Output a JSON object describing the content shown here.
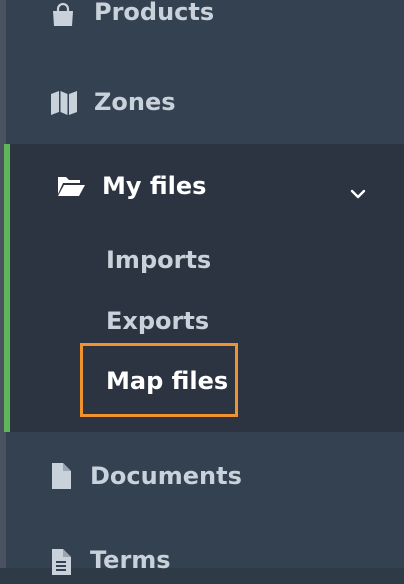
{
  "sidebar": {
    "items": [
      {
        "label": "Products",
        "icon": "shopping-bag-icon"
      },
      {
        "label": "Zones",
        "icon": "map-icon"
      },
      {
        "label": "My files",
        "icon": "folder-open-icon",
        "expanded": true,
        "children": [
          {
            "label": "Imports"
          },
          {
            "label": "Exports"
          },
          {
            "label": "Map files",
            "highlighted": true
          }
        ]
      },
      {
        "label": "Documents",
        "icon": "file-icon"
      },
      {
        "label": "Terms",
        "icon": "file-text-icon"
      }
    ]
  },
  "colors": {
    "sidebar_bg": "#344150",
    "group_bg": "#2b3440",
    "active_bar": "#5fb55a",
    "highlight": "#f0922e",
    "text_muted": "#c9d1da",
    "text_active": "#ffffff"
  }
}
